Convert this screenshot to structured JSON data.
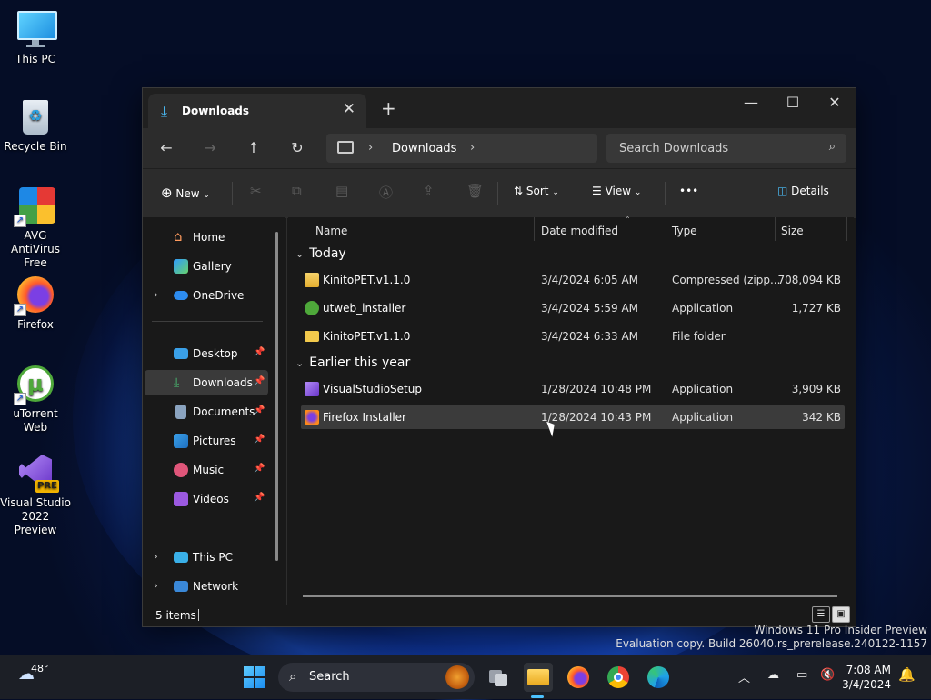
{
  "desktop": {
    "icons": [
      {
        "label": "This PC"
      },
      {
        "label": "Recycle Bin"
      },
      {
        "label": "AVG AntiVirus Free"
      },
      {
        "label": "Firefox"
      },
      {
        "label": "uTorrent Web"
      },
      {
        "label": "Visual Studio 2022 Preview"
      }
    ],
    "vs_badge": "PRE",
    "watermark_line1": "Windows 11 Pro Insider Preview",
    "watermark_line2": "Evaluation copy. Build 26040.rs_prerelease.240122-1157"
  },
  "window": {
    "tab_title": "Downloads",
    "tab_close": "✕",
    "new_tab": "+",
    "minimize": "—",
    "maximize": "☐",
    "close": "✕"
  },
  "navbar": {
    "back": "←",
    "forward": "→",
    "up": "↑",
    "refresh": "↻",
    "breadcrumb": "Downloads",
    "search_placeholder": "Search Downloads"
  },
  "toolbar": {
    "new_label": "New",
    "sort_label": "Sort",
    "view_label": "View",
    "more_label": "•••",
    "details_label": "Details"
  },
  "navpane": {
    "items": [
      {
        "label": "Home"
      },
      {
        "label": "Gallery"
      },
      {
        "label": "OneDrive"
      },
      {
        "label": "Desktop"
      },
      {
        "label": "Downloads"
      },
      {
        "label": "Documents"
      },
      {
        "label": "Pictures"
      },
      {
        "label": "Music"
      },
      {
        "label": "Videos"
      },
      {
        "label": "This PC"
      },
      {
        "label": "Network"
      }
    ]
  },
  "filelist": {
    "columns": [
      "Name",
      "Date modified",
      "Type",
      "Size"
    ],
    "groups": [
      {
        "label": "Today"
      },
      {
        "label": "Earlier this year"
      }
    ],
    "files": [
      {
        "name": "KinitoPET.v1.1.0",
        "date": "3/4/2024 6:05 AM",
        "type": "Compressed (zipp...",
        "size": "708,094 KB"
      },
      {
        "name": "utweb_installer",
        "date": "3/4/2024 5:59 AM",
        "type": "Application",
        "size": "1,727 KB"
      },
      {
        "name": "KinitoPET.v1.1.0",
        "date": "3/4/2024 6:33 AM",
        "type": "File folder",
        "size": ""
      },
      {
        "name": "VisualStudioSetup",
        "date": "1/28/2024 10:48 PM",
        "type": "Application",
        "size": "3,909 KB"
      },
      {
        "name": "Firefox Installer",
        "date": "1/28/2024 10:43 PM",
        "type": "Application",
        "size": "342 KB"
      }
    ]
  },
  "status": {
    "item_count": "5 items"
  },
  "taskbar": {
    "weather_temp": "48°",
    "search_label": "Search",
    "time": "7:08 AM",
    "date": "3/4/2024"
  }
}
